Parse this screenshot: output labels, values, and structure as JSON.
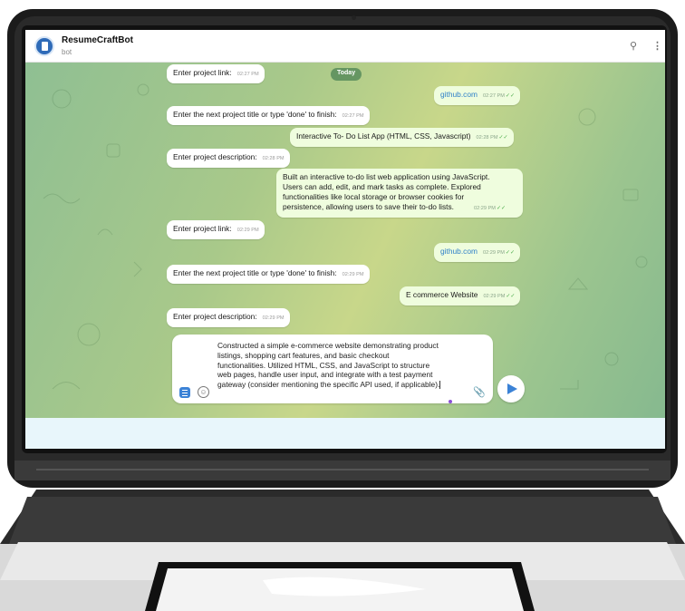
{
  "header": {
    "bot_name": "ResumeCraftBot",
    "bot_sub": "bot",
    "search_icon": "search-icon",
    "menu_icon": "kebab-menu-icon"
  },
  "chat": {
    "today_label": "Today",
    "messages": [
      {
        "text": "Enter project link:",
        "time": "02:27 PM"
      },
      {
        "text": "github.com",
        "time": "02:27 PM"
      },
      {
        "text": "Enter the next project title or type 'done' to finish:",
        "time": "02:27 PM"
      },
      {
        "text": "Interactive To- Do List App (HTML, CSS, Javascript)",
        "time": "02:28 PM"
      },
      {
        "text": "Enter project description:",
        "time": "02:28 PM"
      },
      {
        "lines": [
          "Built an interactive to-do list web application using JavaScript.",
          "Users can add, edit, and mark tasks as complete. Explored",
          "functionalities like local storage or browser cookies for",
          "persistence, allowing users to save their to-do lists."
        ],
        "time": "02:29 PM"
      },
      {
        "text": "Enter project link:",
        "time": "02:29 PM"
      },
      {
        "text": "github.com",
        "time": "02:29 PM"
      },
      {
        "text": "Enter the next project title or type 'done' to finish:",
        "time": "02:29 PM"
      },
      {
        "text": "E commerce Website",
        "time": "02:29 PM"
      },
      {
        "text": "Enter project description:",
        "time": "02:29 PM"
      }
    ]
  },
  "composer": {
    "lines": [
      "Constructed a simple e-commerce website demonstrating product",
      "listings, shopping cart features, and basic checkout",
      "functionalities. Utilized HTML, CSS, and JavaScript to structure",
      "web pages, handle user input, and integrate with a test payment",
      "gateway (consider mentioning the specific API used, if applicable)."
    ],
    "menu_icon": "bot-menu-icon",
    "emoji_icon": "emoji-icon",
    "attach_icon": "paperclip-icon",
    "send_icon": "send-icon"
  },
  "colors": {
    "accent": "#3b82d6",
    "outgoing_bubble": "#effdde",
    "incoming_bubble": "#ffffff",
    "wallpaper": "#a9c98a"
  }
}
